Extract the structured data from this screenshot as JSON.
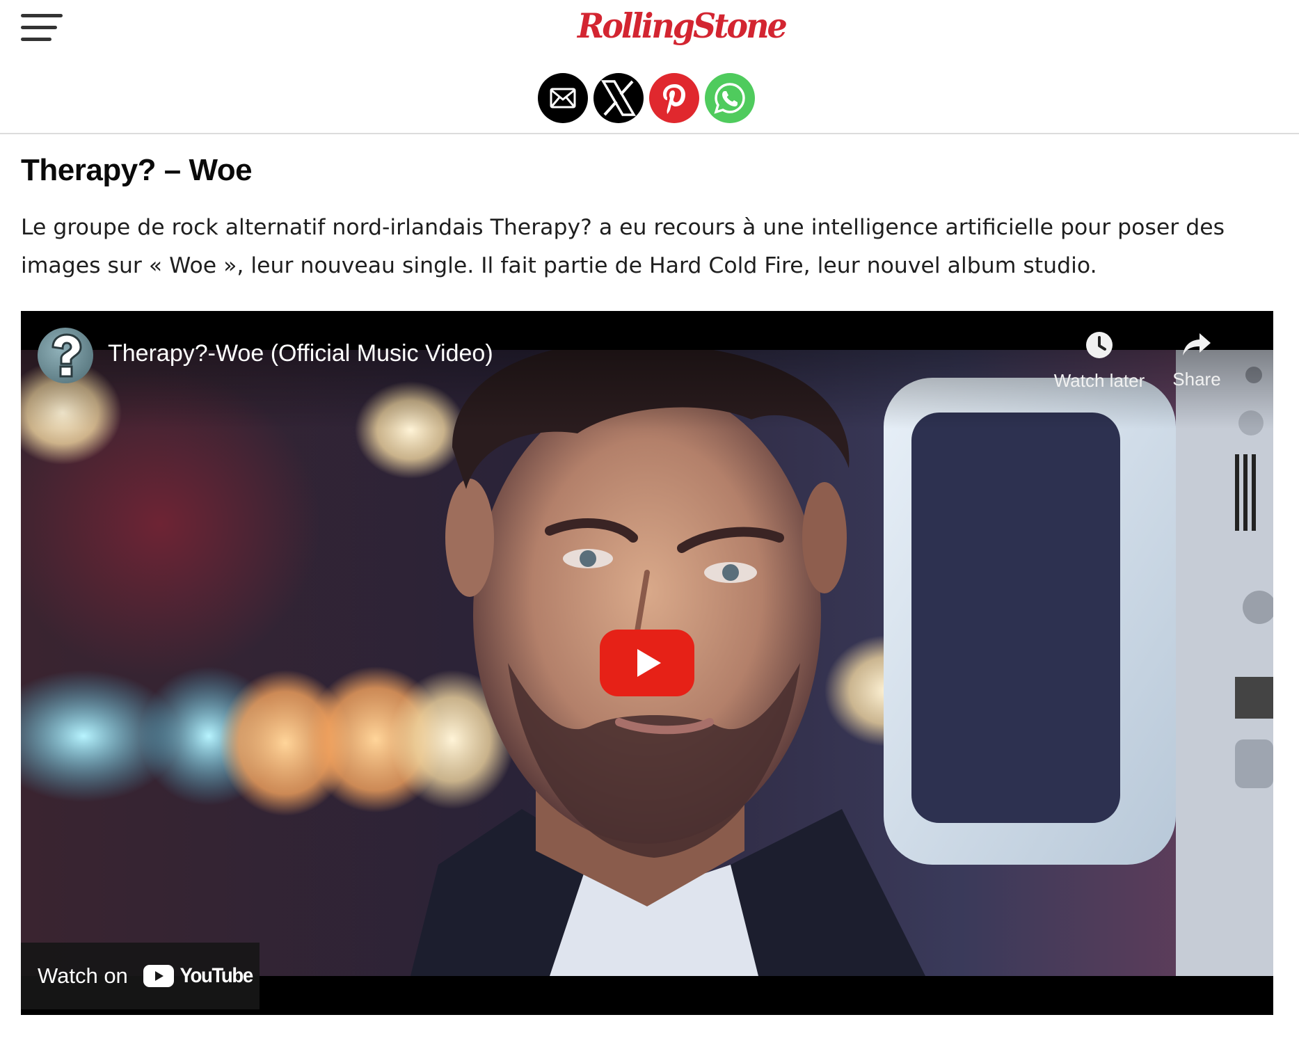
{
  "header": {
    "logo_text": "RollingStone",
    "menu_icon": "hamburger-menu-icon",
    "share_buttons": [
      {
        "name": "email",
        "icon": "email-icon",
        "color": "#000000"
      },
      {
        "name": "x",
        "icon": "x-icon",
        "color": "#000000"
      },
      {
        "name": "pinterest",
        "icon": "pinterest-icon",
        "color": "#e0282e"
      },
      {
        "name": "whatsapp",
        "icon": "whatsapp-icon",
        "color": "#4fcb5d"
      }
    ]
  },
  "article": {
    "title": "Therapy? – Woe",
    "body": "Le groupe de rock alternatif nord-irlandais Therapy? a eu recours à une intelligence artificielle pour poser des images sur « Woe », leur nouveau single. Il fait partie de Hard Cold Fire, leur nouvel album studio."
  },
  "video": {
    "title": "Therapy?-Woe (Official Music Video)",
    "channel_avatar_icon": "question-mark-icon",
    "watch_later_label": "Watch later",
    "share_label": "Share",
    "watch_on_label": "Watch on",
    "youtube_wordmark": "YouTube",
    "play_button_color": "#e62117",
    "brand_color": "#d32531"
  }
}
